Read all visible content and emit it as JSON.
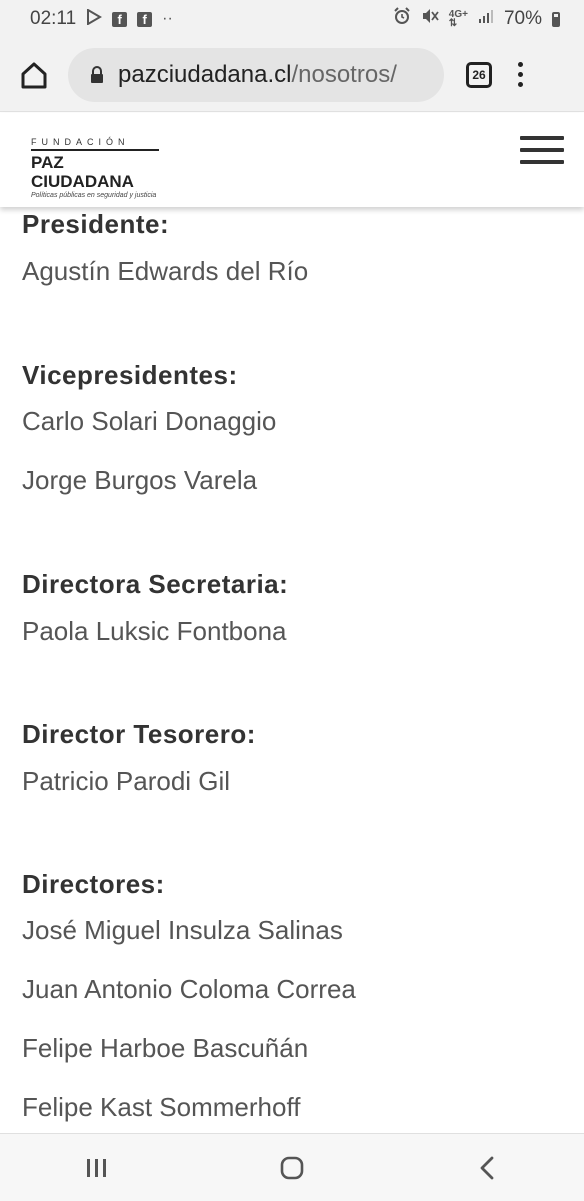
{
  "status_bar": {
    "time": "02:11",
    "left_icons": [
      "play-store-icon",
      "facebook-icon",
      "facebook-icon",
      "more-dots-icon"
    ],
    "fb_glyph": "f",
    "dots": "··",
    "net_top": "4G+",
    "battery": "70%",
    "right_icons": [
      "alarm-icon",
      "mute-icon",
      "network-4g-icon",
      "signal-icon",
      "battery-icon"
    ]
  },
  "browser": {
    "url_domain": "pazciudadana.cl",
    "url_path": "/nosotros/",
    "tab_count": "26"
  },
  "site": {
    "logo_top": "FUNDACIÓN",
    "logo_main": "PAZ CIUDADANA",
    "logo_sub": "Políticas públicas en seguridad y justicia"
  },
  "board": {
    "presidente_label": "Presidente:",
    "presidente": "Agustín Edwards del Río",
    "vice_label": "Vicepresidentes:",
    "vice_1": "Carlo Solari Donaggio",
    "vice_2": "Jorge Burgos Varela",
    "secretaria_label": "Directora Secretaria:",
    "secretaria": "Paola Luksic Fontbona",
    "tesorero_label": "Director Tesorero:",
    "tesorero": "Patricio Parodi Gil",
    "directores_label": "Directores:",
    "director_1": "José Miguel Insulza Salinas",
    "director_2": "Juan Antonio Coloma Correa",
    "director_3": "Felipe Harboe Bascuñán",
    "director_4": "Felipe Kast Sommerhoff"
  },
  "colors": {
    "text_heading": "#333333",
    "text_body": "#555555",
    "chrome_bg": "#f2f2f2"
  }
}
